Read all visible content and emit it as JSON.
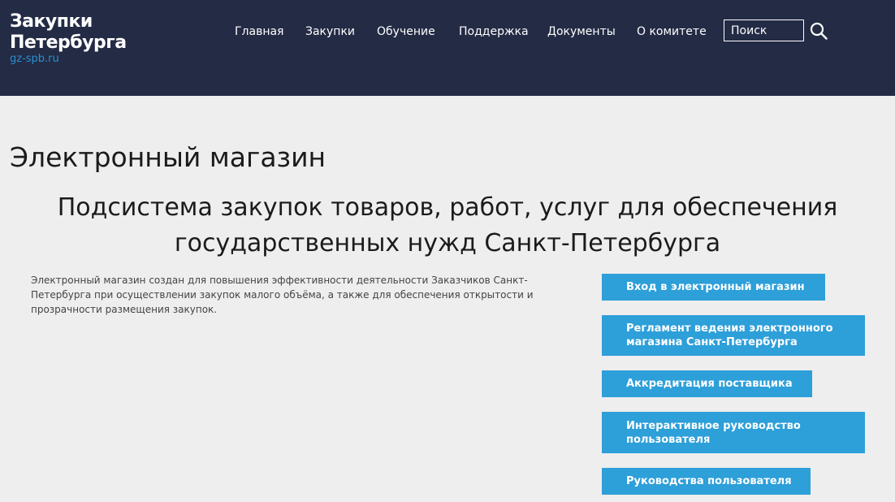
{
  "header": {
    "logo_line1": "Закупки",
    "logo_line2": "Петербурга",
    "logo_domain": "gz-spb.ru",
    "nav": [
      {
        "label": "Главная"
      },
      {
        "label": "Закупки"
      },
      {
        "label": "Обучение"
      },
      {
        "label": "Поддержка"
      },
      {
        "label": "Документы"
      },
      {
        "label": "О комитете"
      }
    ],
    "search": {
      "placeholder": "Поиск",
      "value": ""
    }
  },
  "main": {
    "title": "Электронный магазин",
    "subtitle": "Подсистема закупок товаров, работ, услуг для обеспечения государственных нужд Санкт-Петербурга",
    "intro": "Электронный магазин создан для повышения эффективности деятельности Заказчиков Санкт-Петербурга при осуществлении закупок малого объёма, а также для обеспечения открытости и прозрачности размещения закупок.",
    "buttons": [
      {
        "label": "Вход в электронный магазин"
      },
      {
        "label": "Регламент ведения электронного магазина Санкт-Петербурга"
      },
      {
        "label": "Аккредитация поставщика"
      },
      {
        "label": "Интерактивное руководство пользователя"
      },
      {
        "label": "Руководства пользователя"
      }
    ]
  },
  "colors": {
    "header_bg": "#232b45",
    "page_bg": "#eeeeee",
    "accent": "#2d9fd9",
    "domain_link": "#2a8fd0"
  },
  "icons": {
    "search": "search-icon"
  }
}
